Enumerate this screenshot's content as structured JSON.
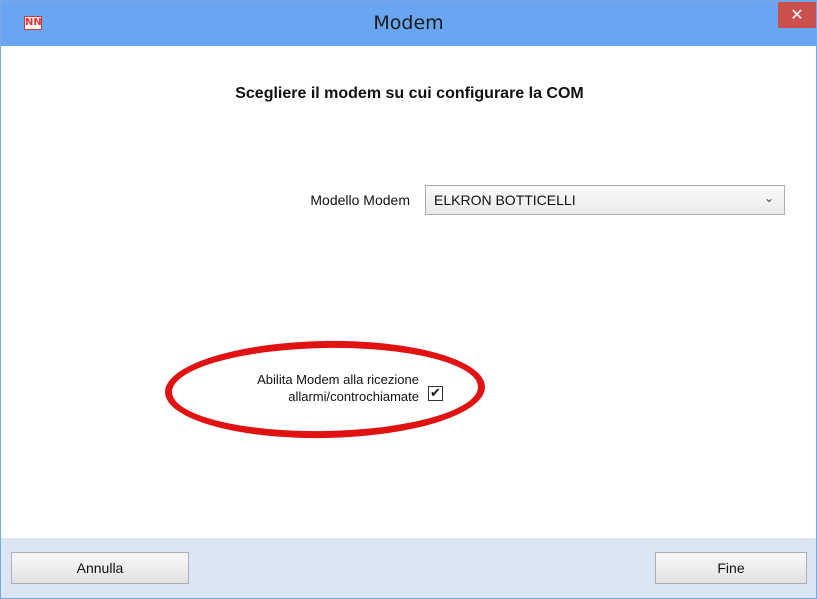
{
  "window": {
    "title": "Modem",
    "app_icon": "NN",
    "close_glyph": "✕"
  },
  "main": {
    "heading": "Scegliere il modem su cui configurare la COM",
    "model_label": "Modello Modem",
    "model_value": "ELKRON BOTTICELLI",
    "dropdown_glyph": "⌄",
    "checkbox_label_line1": "Abilita Modem alla ricezione",
    "checkbox_label_line2": "allarmi/controchiamate",
    "checkbox_checked": true,
    "check_glyph": "✔"
  },
  "footer": {
    "cancel_label": "Annulla",
    "finish_label": "Fine"
  },
  "colors": {
    "titlebar": "#6aa5f2",
    "close": "#c9504b",
    "highlight": "#e01212",
    "footer": "#dbe6f4"
  }
}
